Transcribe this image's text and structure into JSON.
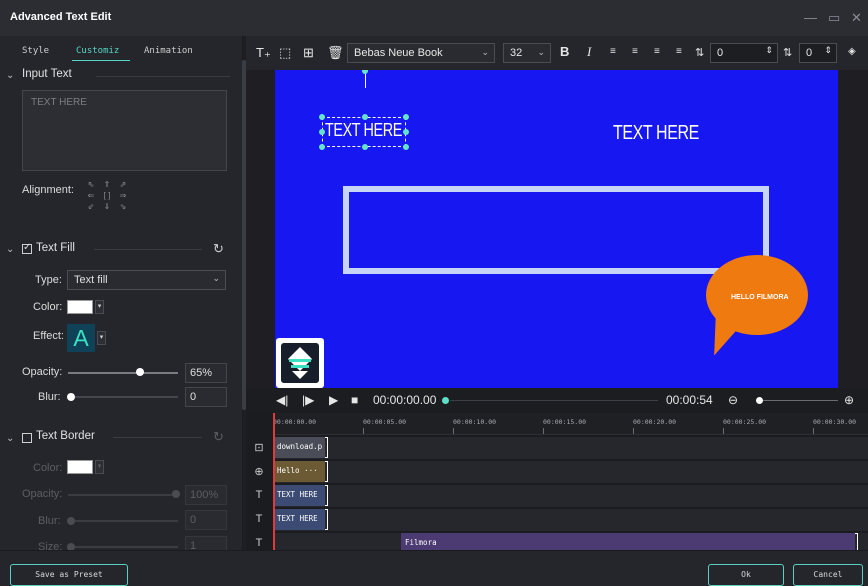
{
  "window": {
    "title": "Advanced Text Edit"
  },
  "tabs": [
    "Style",
    "Customiz",
    "Animation"
  ],
  "input_text": {
    "section_label": "Input Text",
    "placeholder": "TEXT HERE"
  },
  "alignment": {
    "label": "Alignment:",
    "glyphs": [
      "⇖",
      "⇑",
      "⇗",
      "⇐",
      "[ ]",
      "⇒",
      "⇙",
      "⇓",
      "⇘"
    ]
  },
  "text_fill": {
    "section_label": "Text Fill",
    "checked": true,
    "type_label": "Type:",
    "type_value": "Text fill",
    "color_label": "Color:",
    "color_value": "#ffffff",
    "effect_label": "Effect:",
    "effect_glyph": "A",
    "opacity_label": "Opacity:",
    "opacity_value": "65%",
    "opacity_fraction": 0.65,
    "blur_label": "Blur:",
    "blur_value": "0"
  },
  "text_border": {
    "section_label": "Text Border",
    "checked": false,
    "color_label": "Color:",
    "color_value": "#ffffff",
    "opacity_label": "Opacity:",
    "opacity_value": "100%",
    "blur_label": "Blur:",
    "blur_value": "0",
    "size_label": "Size:",
    "size_value": "1"
  },
  "toolbar": {
    "font": "Bebas Neue Book",
    "size": "32",
    "bold": "B",
    "italic": "I",
    "char_spacing": "0",
    "line_spacing": "0"
  },
  "canvas": {
    "text_1": "TEXT HERE",
    "text_2": "TEXT HERE",
    "bubble_text": "HELLO FILMORA",
    "background_color": "#1717f2",
    "bubble_color": "#ef7a10",
    "rect_color": "#c6d4f5"
  },
  "playback": {
    "current_time": "00:00:00.00",
    "duration": "00:00:54"
  },
  "timeline": {
    "ruler": [
      "00:00:00.00",
      "00:00:05.00",
      "00:00:10.00",
      "00:00:15.00",
      "00:00:20.00",
      "00:00:25.00",
      "00:00:30.00"
    ],
    "tracks": [
      {
        "icon": "⊡",
        "clip": "download.p",
        "color": "#4a4d57"
      },
      {
        "icon": "⊕",
        "clip": "Hello ···",
        "color": "#6b5a34"
      },
      {
        "icon": "T",
        "clip": "TEXT HERE",
        "color": "#3c4b73"
      },
      {
        "icon": "T",
        "clip": "TEXT HERE",
        "color": "#3c4b73"
      },
      {
        "icon": "T",
        "clip": "Filmora",
        "color": "#4c3a73"
      }
    ]
  },
  "footer": {
    "save_preset": "Save as Preset",
    "ok": "Ok",
    "cancel": "Cancel"
  },
  "colors": {
    "accent": "#5bd0c1",
    "panel": "#25262b"
  }
}
